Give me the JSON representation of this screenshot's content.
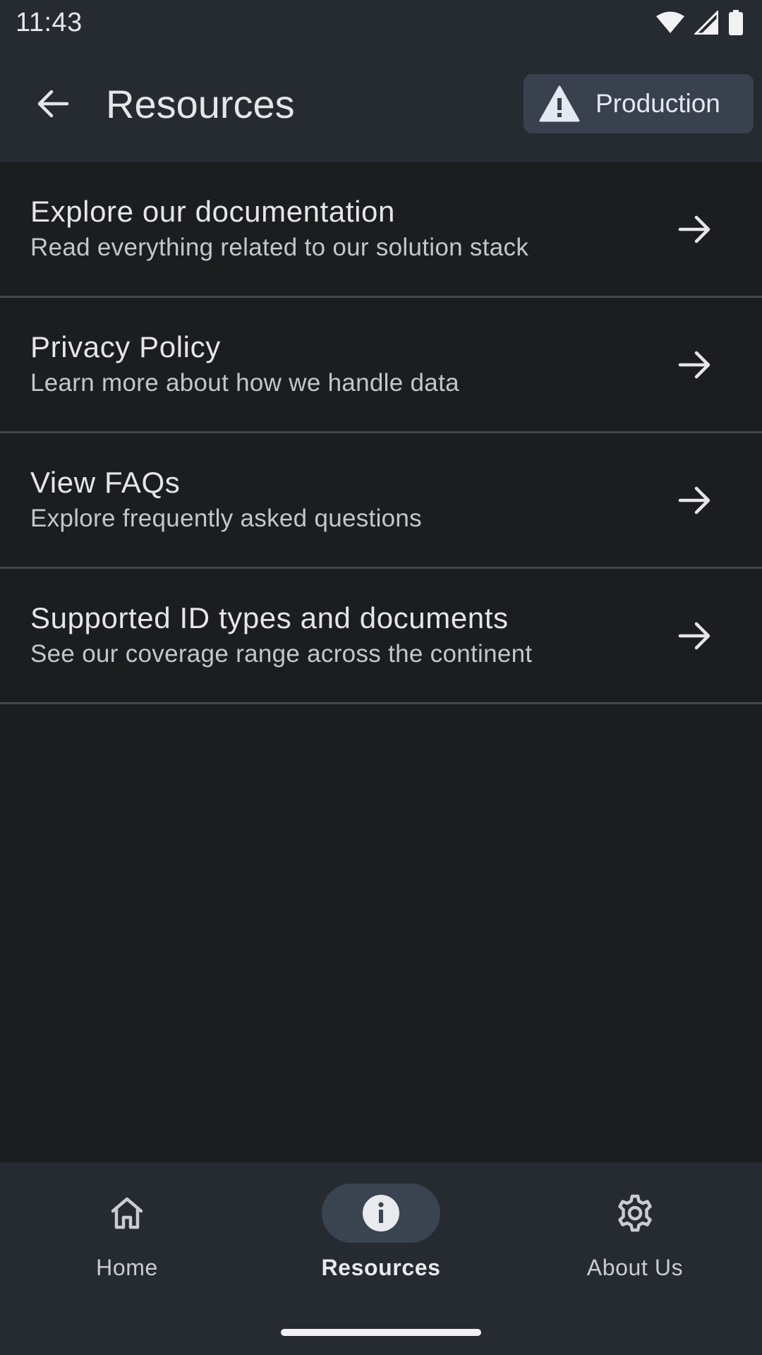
{
  "status_bar": {
    "time": "11:43",
    "icons": [
      "wifi-icon",
      "signal-icon",
      "battery-icon"
    ]
  },
  "app_bar": {
    "title": "Resources",
    "back_icon": "arrow-left-icon",
    "environment_chip": {
      "label": "Production",
      "icon": "warning-icon",
      "color": "#38414d"
    }
  },
  "list": {
    "items": [
      {
        "title": "Explore our documentation",
        "subtitle": "Read everything related to our solution stack"
      },
      {
        "title": "Privacy Policy",
        "subtitle": "Learn more about how we handle data"
      },
      {
        "title": "View FAQs",
        "subtitle": "Explore frequently asked questions"
      },
      {
        "title": "Supported ID types and documents",
        "subtitle": "See our coverage range across the continent"
      }
    ]
  },
  "bottom_nav": {
    "items": [
      {
        "label": "Home",
        "icon": "home-icon",
        "active": false
      },
      {
        "label": "Resources",
        "icon": "info-icon",
        "active": true
      },
      {
        "label": "About Us",
        "icon": "gear-icon",
        "active": false
      }
    ]
  },
  "colors": {
    "background": "#1c1d1f",
    "bars": "#262a31",
    "accent_pill": "#3a4350",
    "divider": "#45474c"
  }
}
